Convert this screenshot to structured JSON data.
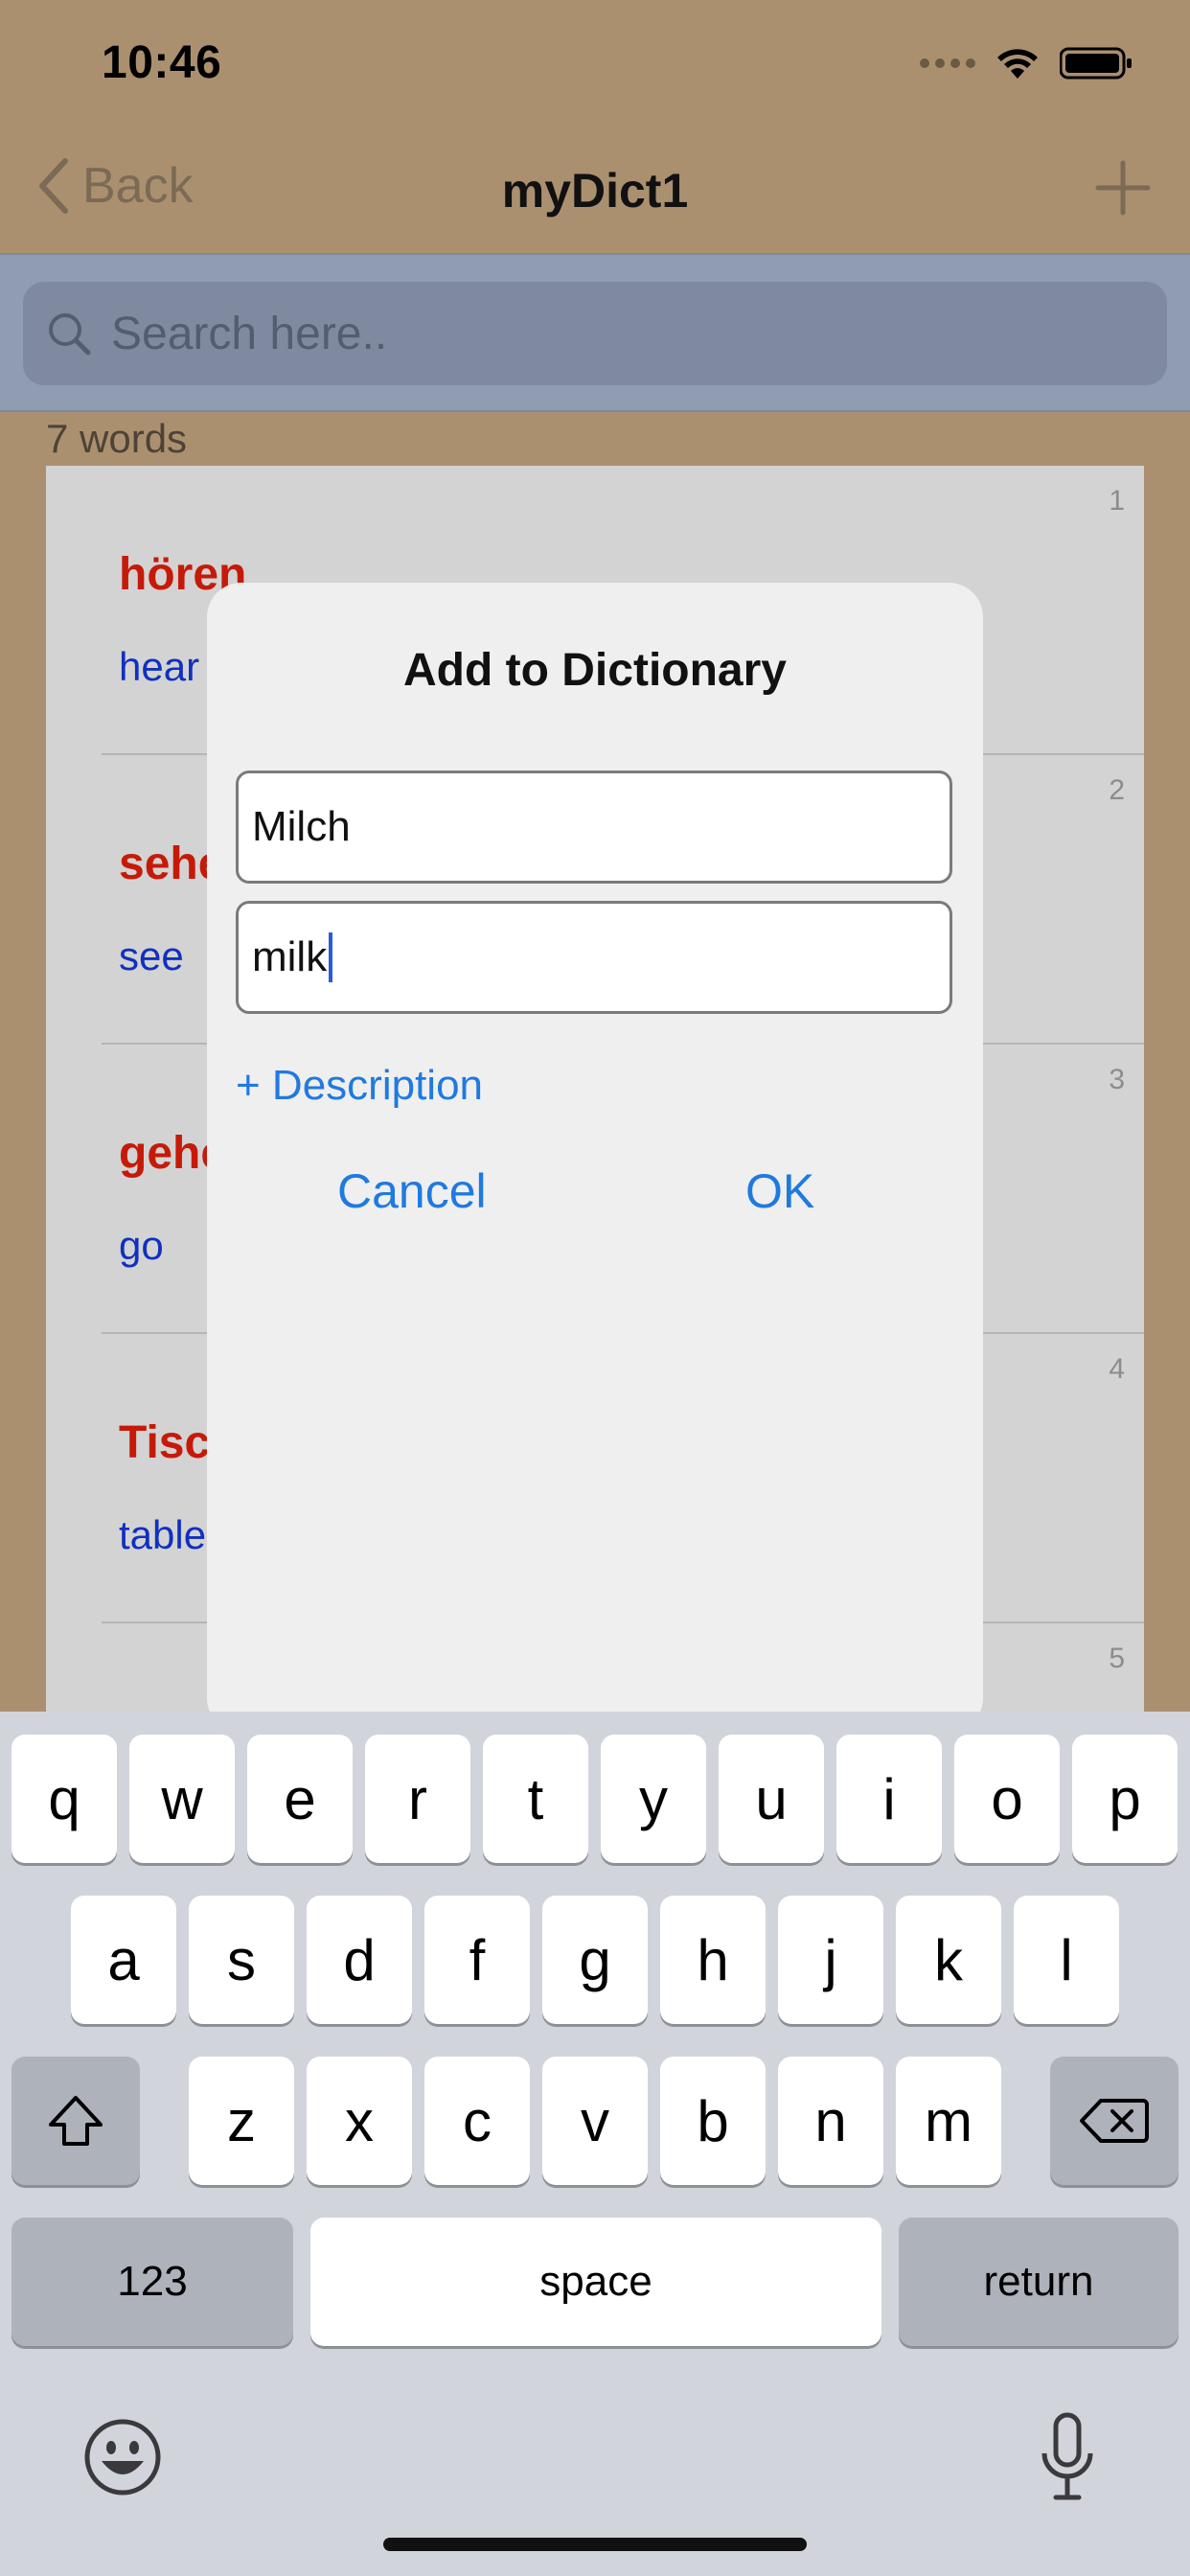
{
  "status_bar": {
    "time": "10:46"
  },
  "nav": {
    "back_label": "Back",
    "title": "myDict1"
  },
  "search": {
    "placeholder": "Search here.."
  },
  "word_count": "7 words",
  "list": [
    {
      "num": "1",
      "word": "hören",
      "translation": "hear"
    },
    {
      "num": "2",
      "word": "sehen",
      "translation": "see"
    },
    {
      "num": "3",
      "word": "gehen",
      "translation": "go"
    },
    {
      "num": "4",
      "word": "Tisch",
      "translation": "table"
    },
    {
      "num": "5",
      "word": "",
      "translation": ""
    }
  ],
  "dialog": {
    "title": "Add to Dictionary",
    "word_value": "Milch",
    "translation_value": "milk",
    "description_link": "+ Description",
    "cancel_label": "Cancel",
    "ok_label": "OK"
  },
  "keyboard": {
    "row1": [
      "q",
      "w",
      "e",
      "r",
      "t",
      "y",
      "u",
      "i",
      "o",
      "p"
    ],
    "row2": [
      "a",
      "s",
      "d",
      "f",
      "g",
      "h",
      "j",
      "k",
      "l"
    ],
    "row3": [
      "z",
      "x",
      "c",
      "v",
      "b",
      "n",
      "m"
    ],
    "numbers_label": "123",
    "space_label": "space",
    "return_label": "return"
  },
  "colors": {
    "nav_bg": "#ab9070",
    "search_bg": "#8f9cb2",
    "word_color": "#c61a09",
    "translation_color": "#1030c0",
    "link_color": "#1f7ae0"
  }
}
